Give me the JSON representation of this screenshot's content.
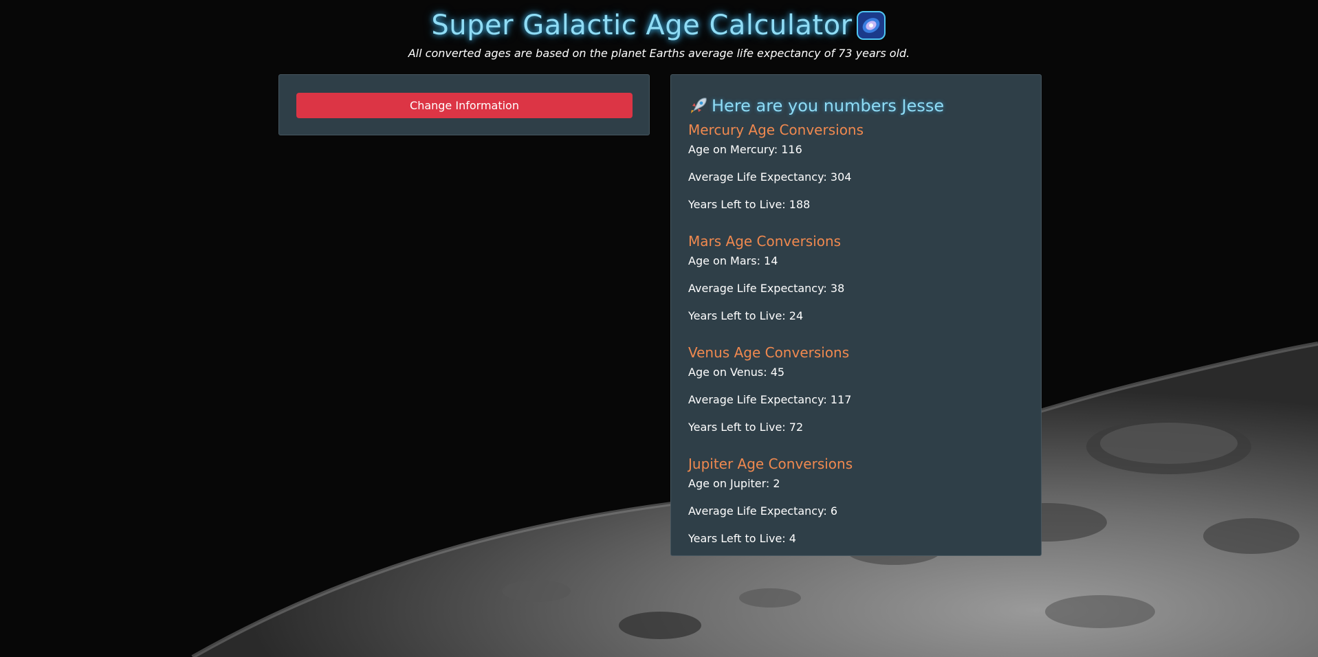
{
  "header": {
    "title": "Super Galactic Age Calculator",
    "subtitle": "All converted ages are based on the planet Earths average life expectancy of 73 years old.",
    "title_icon": "galaxy-icon"
  },
  "left_panel": {
    "change_button_label": "Change Information"
  },
  "results": {
    "greeting_icon": "rocket-icon",
    "greeting": "Here are you numbers Jesse",
    "sections": [
      {
        "title": "Mercury Age Conversions",
        "age": "Age on Mercury: 116",
        "life_expectancy": "Average Life Expectancy: 304",
        "years_left": "Years Left to Live: 188"
      },
      {
        "title": "Mars Age Conversions",
        "age": "Age on Mars: 14",
        "life_expectancy": "Average Life Expectancy: 38",
        "years_left": "Years Left to Live: 24"
      },
      {
        "title": "Venus Age Conversions",
        "age": "Age on Venus: 45",
        "life_expectancy": "Average Life Expectancy: 117",
        "years_left": "Years Left to Live: 72"
      },
      {
        "title": "Jupiter Age Conversions",
        "age": "Age on Jupiter: 2",
        "life_expectancy": "Average Life Expectancy: 6",
        "years_left": "Years Left to Live: 4"
      }
    ]
  },
  "colors": {
    "title_glow": "#8fdcf5",
    "section_heading": "#f0894f",
    "panel_bg": "#2f3f48",
    "button_red": "#dc3545"
  }
}
